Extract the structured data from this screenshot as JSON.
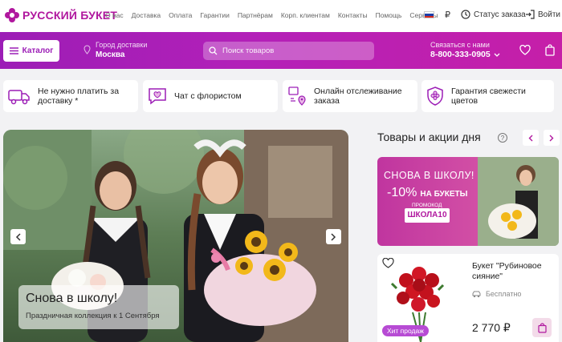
{
  "brand": {
    "name": "РУССКИЙ БУКЕТ",
    "accent": "#b0179e"
  },
  "topnav": [
    "О нас",
    "Доставка",
    "Оплата",
    "Гарантии",
    "Партнёрам",
    "Корп. клиентам",
    "Контакты",
    "Помощь",
    "Сервисы"
  ],
  "currency": "₽",
  "order_status": "Статус заказа",
  "login": "Войти",
  "catalog_btn": "Каталог",
  "city": {
    "label": "Город доставки",
    "value": "Москва"
  },
  "search": {
    "placeholder": "Поиск товаров"
  },
  "contact": {
    "label": "Связаться с нами",
    "phone": "8-800-333-0905"
  },
  "features": [
    {
      "line1": "Не нужно платить за",
      "line2": "доставку *"
    },
    {
      "line1": "Чат с флористом",
      "line2": ""
    },
    {
      "line1": "Онлайн отслеживание",
      "line2": "заказа"
    },
    {
      "line1": "Гарантия свежести",
      "line2": "цветов"
    }
  ],
  "hero": {
    "title": "Снова в школу!",
    "subtitle": "Праздничная коллекция к 1 Сентября"
  },
  "side": {
    "title": "Товары и акции дня",
    "help": "?"
  },
  "promo": {
    "line1": "СНОВА В ШКОЛУ!",
    "discount": "-10%",
    "discount_suffix": "НА БУКЕТЫ",
    "code_label": "ПРОМОКОД",
    "code": "ШКОЛА10"
  },
  "product": {
    "name_line1": "Букет \"Рубиновое",
    "name_line2": "сияние\"",
    "delivery": "Бесплатно",
    "price": "2 770 ₽",
    "badge": "Хит продаж"
  }
}
